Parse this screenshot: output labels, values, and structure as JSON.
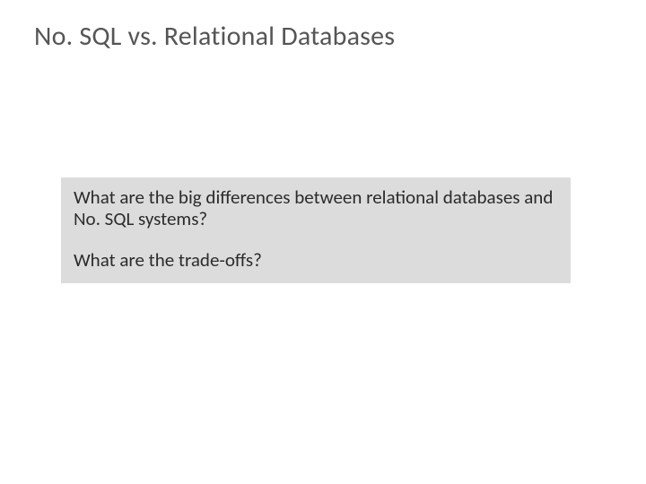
{
  "slide": {
    "title": "No. SQL vs. Relational Databases",
    "question1": "What are the big differences between relational databases and No. SQL systems?",
    "question2": "What are the trade-offs?"
  }
}
